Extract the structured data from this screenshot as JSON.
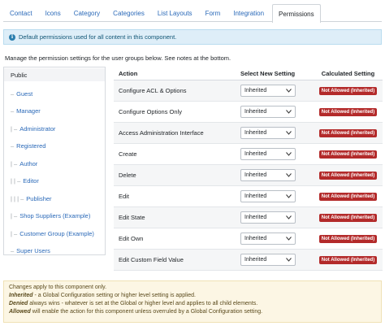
{
  "tabs": [
    "Contact",
    "Icons",
    "Category",
    "Categories",
    "List Layouts",
    "Form",
    "Integration",
    "Permissions"
  ],
  "active_tab": "Permissions",
  "alert": {
    "icon": "info-icon",
    "text": "Default permissions used for all content in this component."
  },
  "manage_text": "Manage the permission settings for the user groups below. See notes at the bottom.",
  "groups": [
    {
      "prefix": "",
      "label": "Public"
    },
    {
      "prefix": "–",
      "label": "Guest"
    },
    {
      "prefix": "–",
      "label": "Manager"
    },
    {
      "prefix": "| –",
      "label": "Administrator"
    },
    {
      "prefix": "–",
      "label": "Registered"
    },
    {
      "prefix": "| –",
      "label": "Author"
    },
    {
      "prefix": "| | –",
      "label": "Editor"
    },
    {
      "prefix": "| | | –",
      "label": "Publisher"
    },
    {
      "prefix": "| –",
      "label": "Shop Suppliers (Example)"
    },
    {
      "prefix": "| –",
      "label": "Customer Group (Example)"
    },
    {
      "prefix": "–",
      "label": "Super Users"
    }
  ],
  "table": {
    "headers": {
      "action": "Action",
      "select": "Select New Setting",
      "calc": "Calculated Setting"
    },
    "rows": [
      {
        "action": "Configure ACL & Options",
        "setting": "Inherited",
        "calculated": "Not Allowed (Inherited)"
      },
      {
        "action": "Configure Options Only",
        "setting": "Inherited",
        "calculated": "Not Allowed (Inherited)"
      },
      {
        "action": "Access Administration Interface",
        "setting": "Inherited",
        "calculated": "Not Allowed (Inherited)"
      },
      {
        "action": "Create",
        "setting": "Inherited",
        "calculated": "Not Allowed (Inherited)"
      },
      {
        "action": "Delete",
        "setting": "Inherited",
        "calculated": "Not Allowed (Inherited)"
      },
      {
        "action": "Edit",
        "setting": "Inherited",
        "calculated": "Not Allowed (Inherited)"
      },
      {
        "action": "Edit State",
        "setting": "Inherited",
        "calculated": "Not Allowed (Inherited)"
      },
      {
        "action": "Edit Own",
        "setting": "Inherited",
        "calculated": "Not Allowed (Inherited)"
      },
      {
        "action": "Edit Custom Field Value",
        "setting": "Inherited",
        "calculated": "Not Allowed (Inherited)"
      }
    ]
  },
  "notes": {
    "line1": "Changes apply to this component only.",
    "line2_lead": "Inherited",
    "line2_rest": " - a Global Configuration setting or higher level setting is applied.",
    "line3_lead": "Denied",
    "line3_rest": " always wins - whatever is set at the Global or higher level and applies to all child elements.",
    "line4_lead": "Allowed",
    "line4_rest": " will enable the action for this component unless overruled by a Global Configuration setting."
  },
  "colors": {
    "link": "#2a69b8",
    "badge": "#b32a2a",
    "alert_bg": "#deeef8",
    "notes_bg": "#fcf6e4"
  }
}
